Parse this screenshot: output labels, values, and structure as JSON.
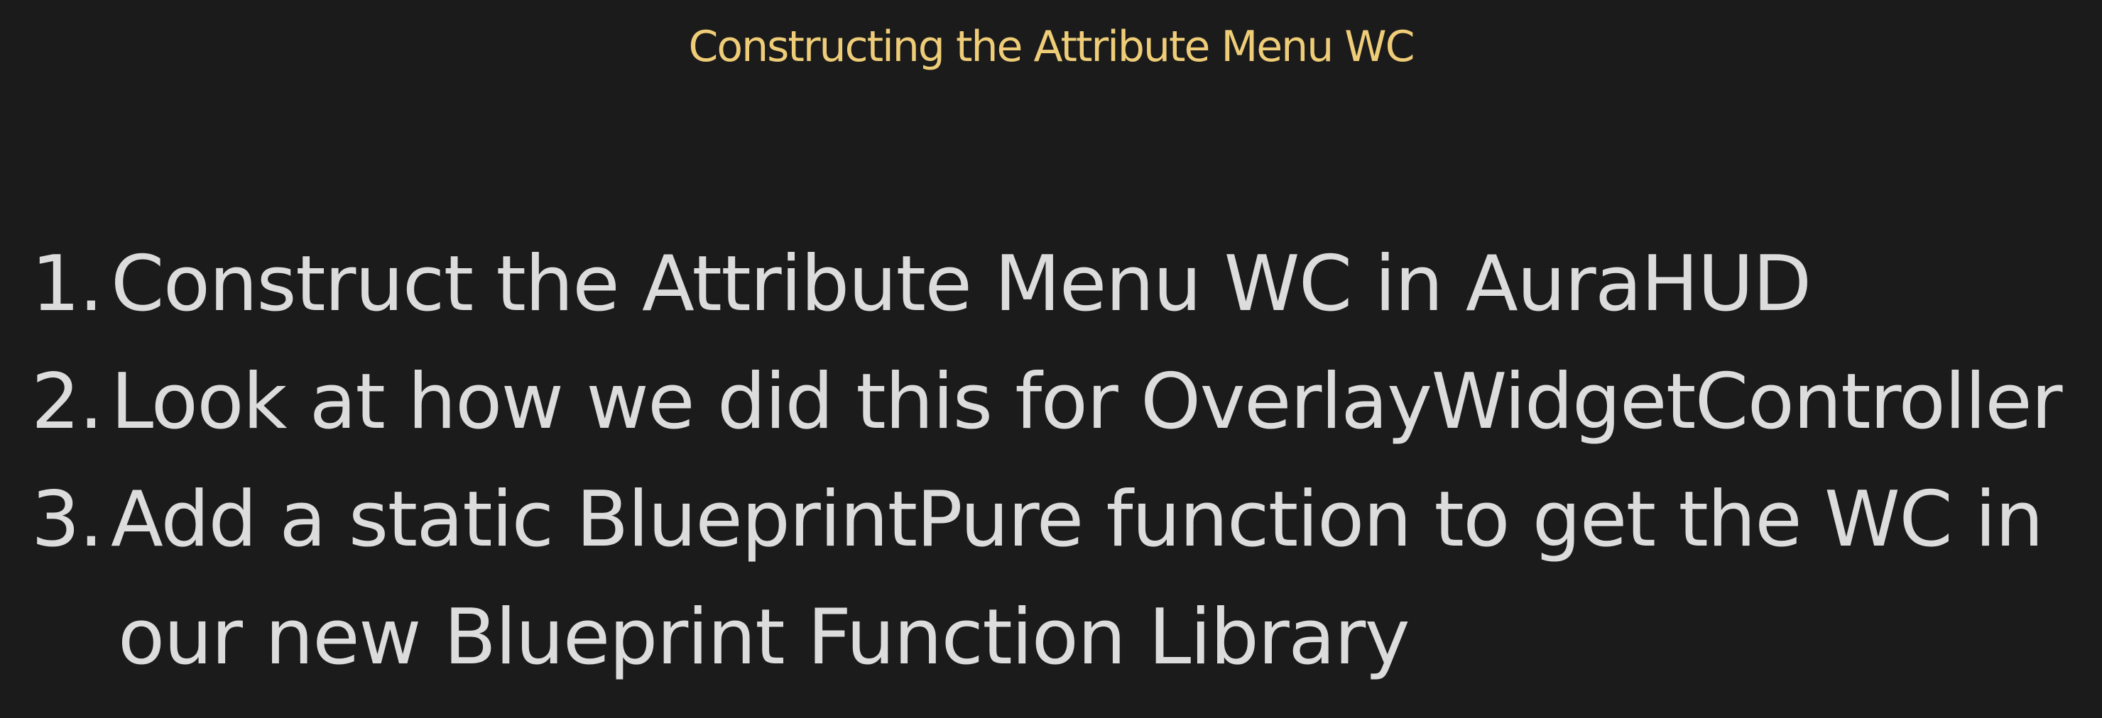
{
  "slide": {
    "title": "Constructing the Attribute Menu WC",
    "items": [
      {
        "number": "1.",
        "lines": [
          "Construct the Attribute Menu WC in AuraHUD"
        ]
      },
      {
        "number": "2.",
        "lines": [
          "Look at how we did this for OverlayWidgetController"
        ]
      },
      {
        "number": "3.",
        "lines": [
          "Add a static BlueprintPure function to get the WC in",
          "our new Blueprint Function Library"
        ]
      }
    ]
  },
  "colors": {
    "background": "#1b1b1b",
    "title": "#efcd78",
    "body_text": "#dcdcdc"
  }
}
